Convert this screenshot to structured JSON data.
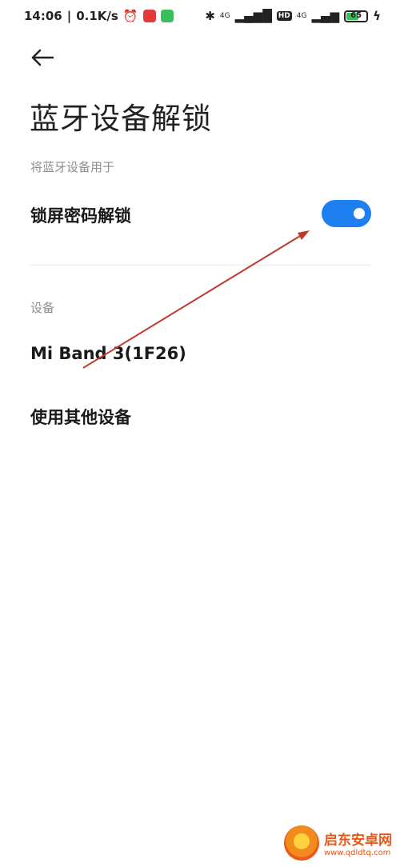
{
  "status_bar": {
    "time": "14:06",
    "net_speed": "0.1K/s",
    "battery_level": "65",
    "battery_fraction": 0.65,
    "signal_1": "4G",
    "signal_2": "4G",
    "hd_label": "HD"
  },
  "header": {
    "back_icon": "back-arrow-icon",
    "title": "蓝牙设备解锁"
  },
  "section_use": {
    "header": "将蓝牙设备用于",
    "items": [
      {
        "label": "锁屏密码解锁",
        "toggle_on": true
      }
    ]
  },
  "section_devices": {
    "header": "设备",
    "items": [
      {
        "label": "Mi Band 3(1F26)"
      },
      {
        "label": "使用其他设备"
      }
    ]
  },
  "annotation": {
    "type": "red-arrow",
    "color": "#c0392b"
  },
  "watermark": {
    "name": "启东安卓网",
    "url": "www.qdldtq.com"
  },
  "colors": {
    "accent": "#1e7ff0",
    "section_text": "#8e8e93"
  }
}
